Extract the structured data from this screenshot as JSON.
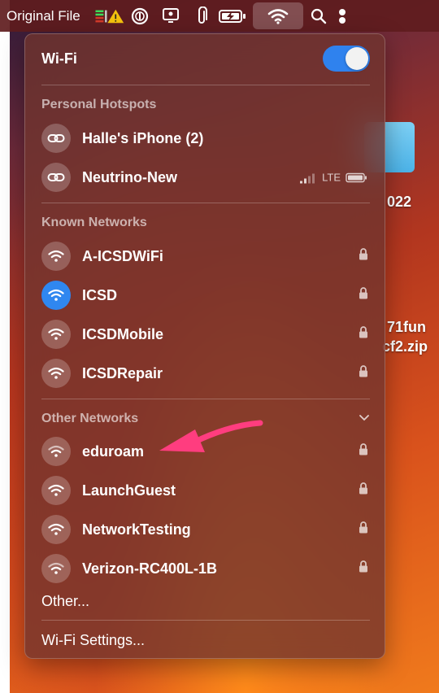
{
  "menubar": {
    "app_title": "Original File",
    "icons": [
      "battery-level-warning-icon",
      "onepassword-icon",
      "screen-sharing-icon",
      "paperclip-icon",
      "battery-charging-icon",
      "wifi-icon",
      "search-icon"
    ]
  },
  "desktop": {
    "label_1": "022",
    "label_2": "71fun",
    "label_3": "cf2.zip"
  },
  "wifi_menu": {
    "title": "Wi-Fi",
    "toggle_on": true,
    "personal_hotspots": {
      "label": "Personal Hotspots",
      "items": [
        {
          "name": "Halle's iPhone (2)",
          "icon": "hotspot-link-icon"
        },
        {
          "name": "Neutrino-New",
          "icon": "hotspot-link-icon",
          "network_type": "LTE"
        }
      ]
    },
    "known_networks": {
      "label": "Known Networks",
      "items": [
        {
          "name": "A-ICSDWiFi",
          "secured": true,
          "connected": false
        },
        {
          "name": "ICSD",
          "secured": true,
          "connected": true
        },
        {
          "name": "ICSDMobile",
          "secured": true,
          "connected": false
        },
        {
          "name": "ICSDRepair",
          "secured": true,
          "connected": false
        }
      ]
    },
    "other_networks": {
      "label": "Other Networks",
      "items": [
        {
          "name": "eduroam",
          "secured": true
        },
        {
          "name": "LaunchGuest",
          "secured": true
        },
        {
          "name": "NetworkTesting",
          "secured": true
        },
        {
          "name": "Verizon-RC400L-1B",
          "secured": true
        }
      ],
      "other_label": "Other..."
    },
    "settings_label": "Wi-Fi Settings..."
  },
  "colors": {
    "accent": "#2f87f0",
    "annotation_arrow": "#ff3d7f"
  }
}
